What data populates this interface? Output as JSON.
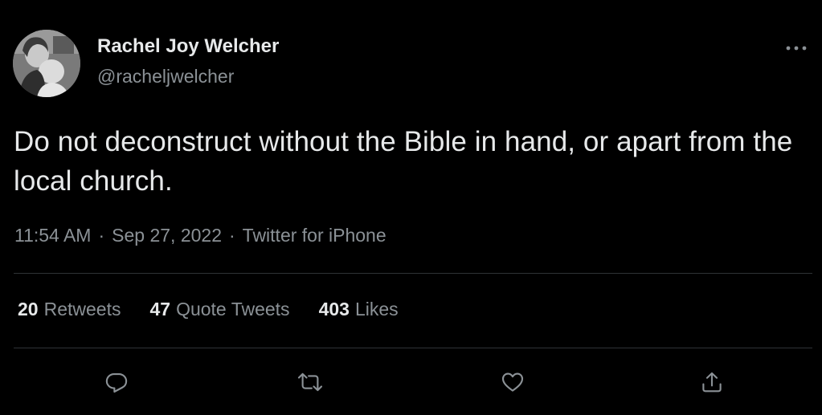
{
  "author": {
    "display_name": "Rachel Joy Welcher",
    "handle": "@racheljwelcher",
    "avatar_icon": "profile-photo"
  },
  "tweet": {
    "text": "Do not deconstruct without the Bible in hand, or apart from the local church.",
    "time": "11:54 AM",
    "date": "Sep 27, 2022",
    "source": "Twitter for iPhone",
    "separator": "·"
  },
  "stats": {
    "retweets": {
      "count": "20",
      "label": "Retweets"
    },
    "quote_tweets": {
      "count": "47",
      "label": "Quote Tweets"
    },
    "likes": {
      "count": "403",
      "label": "Likes"
    }
  },
  "actions": {
    "reply_icon": "reply-icon",
    "retweet_icon": "retweet-icon",
    "like_icon": "heart-icon",
    "share_icon": "share-icon"
  },
  "colors": {
    "background": "#000000",
    "primary_text": "#e7e9ea",
    "secondary_text": "#8b9196",
    "divider": "#2f3336"
  }
}
